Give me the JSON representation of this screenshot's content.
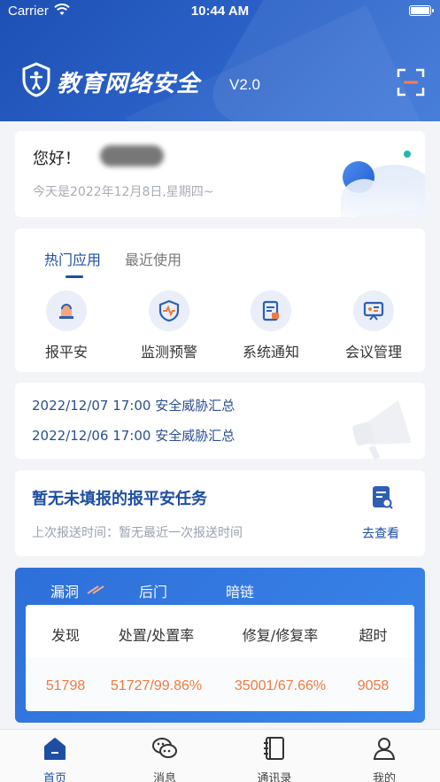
{
  "status_bar": {
    "carrier": "Carrier",
    "time": "10:44 AM"
  },
  "header": {
    "title": "教育网络安全",
    "version": "V2.0"
  },
  "greeting": {
    "hello": "您好！",
    "date": "今天是2022年12月8日,星期四~"
  },
  "apps": {
    "tabs": [
      "热门应用",
      "最近使用"
    ],
    "items": [
      {
        "label": "报平安",
        "icon": "bell-icon"
      },
      {
        "label": "监测预警",
        "icon": "shield-pulse-icon"
      },
      {
        "label": "系统通知",
        "icon": "document-notice-icon"
      },
      {
        "label": "会议管理",
        "icon": "presentation-icon"
      }
    ]
  },
  "notices": [
    "2022/12/07 17:00 安全威胁汇总",
    "2022/12/06 17:00 安全威胁汇总"
  ],
  "task": {
    "title": "暂无未填报的报平安任务",
    "subtitle": "上次报送时间：暂无最近一次报送时间",
    "link": "去查看"
  },
  "stats": {
    "tabs": [
      "漏洞",
      "后门",
      "暗链"
    ],
    "headers": [
      "发现",
      "处置/处置率",
      "修复/修复率",
      "超时"
    ],
    "values": [
      "51798",
      "51727/99.86%",
      "35001/67.66%",
      "9058"
    ],
    "value_color": "#f07a3e"
  },
  "tabbar": {
    "items": [
      {
        "label": "首页",
        "icon": "home-icon"
      },
      {
        "label": "消息",
        "icon": "chat-icon"
      },
      {
        "label": "通讯录",
        "icon": "contacts-book-icon"
      },
      {
        "label": "我的",
        "icon": "user-icon"
      }
    ]
  },
  "colors": {
    "primary": "#1e4ea3",
    "header": "#2558bd",
    "accent": "#f07a3e"
  }
}
